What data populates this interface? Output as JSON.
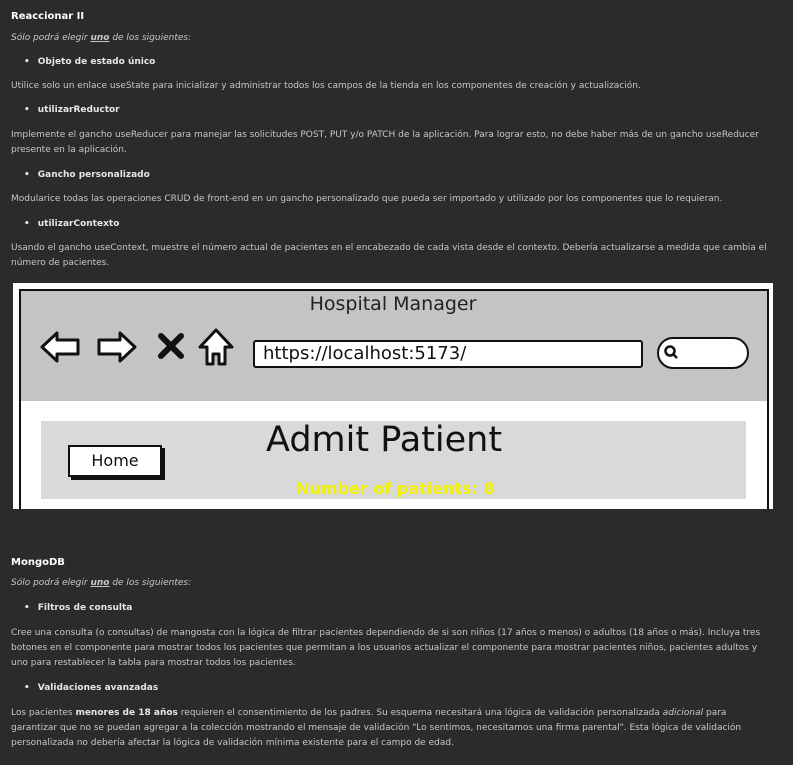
{
  "section1": {
    "heading": "Reaccionar II",
    "choose_prefix": "Sólo podrá elegir ",
    "choose_emph": "uno",
    "choose_suffix": " de los siguientes:",
    "items": [
      {
        "title": "Objeto de estado único",
        "text": "Utilice solo un enlace useState para inicializar y administrar todos los campos de la tienda en los componentes de creación y actualización."
      },
      {
        "title": "utilizarReductor",
        "text": "Implemente el gancho useReducer para manejar las solicitudes POST, PUT y/o PATCH de la aplicación. Para lograr esto, no debe haber más de un gancho useReducer presente en la aplicación."
      },
      {
        "title": "Gancho personalizado",
        "text": "Modularice todas las operaciones CRUD de front-end en un gancho personalizado que pueda ser importado y utilizado por los componentes que lo requieran."
      },
      {
        "title": "utilizarContexto",
        "text": "Usando el gancho useContext, muestre el número actual de pacientes en el encabezado de cada vista desde el contexto. Debería actualizarse a medida que cambia el número de pacientes."
      }
    ]
  },
  "mockup": {
    "app_title": "Hospital Manager",
    "url": "https://localhost:5173/",
    "home_button": "Home",
    "page_heading": "Admit Patient",
    "patients_count": "Number of patients: 8",
    "icons": [
      "back-arrow-icon",
      "forward-arrow-icon",
      "close-icon",
      "home-icon",
      "search-icon"
    ]
  },
  "section2": {
    "heading": "MongoDB",
    "choose_prefix": "Sólo podrá elegir ",
    "choose_emph": "uno",
    "choose_suffix": " de los siguientes:",
    "items": [
      {
        "title": "Filtros de consulta",
        "text": "Cree una consulta (o consultas) de mangosta con la lógica de filtrar pacientes dependiendo de si son niños (17 años o menos) o adultos (18 años o más). Incluya tres botones en el componente para mostrar todos los pacientes que permitan a los usuarios actualizar el componente para mostrar pacientes niños, pacientes adultos y uno para restablecer la tabla para mostrar todos los pacientes."
      },
      {
        "title": "Validaciones avanzadas",
        "text_prefix": "Los pacientes ",
        "text_bold": "menores de 18 años",
        "text_mid": " requieren el consentimiento de los padres. Su esquema necesitará una lógica de validación personalizada ",
        "text_italic": "adicional",
        "text_suffix": " para garantizar que no se puedan agregar a la colección mostrando el mensaje de validación \"Lo sentimos, necesitamos una firma parental\". Esta lógica de validación personalizada no debería afectar la lógica de validación mínima existente para el campo de edad."
      }
    ]
  }
}
